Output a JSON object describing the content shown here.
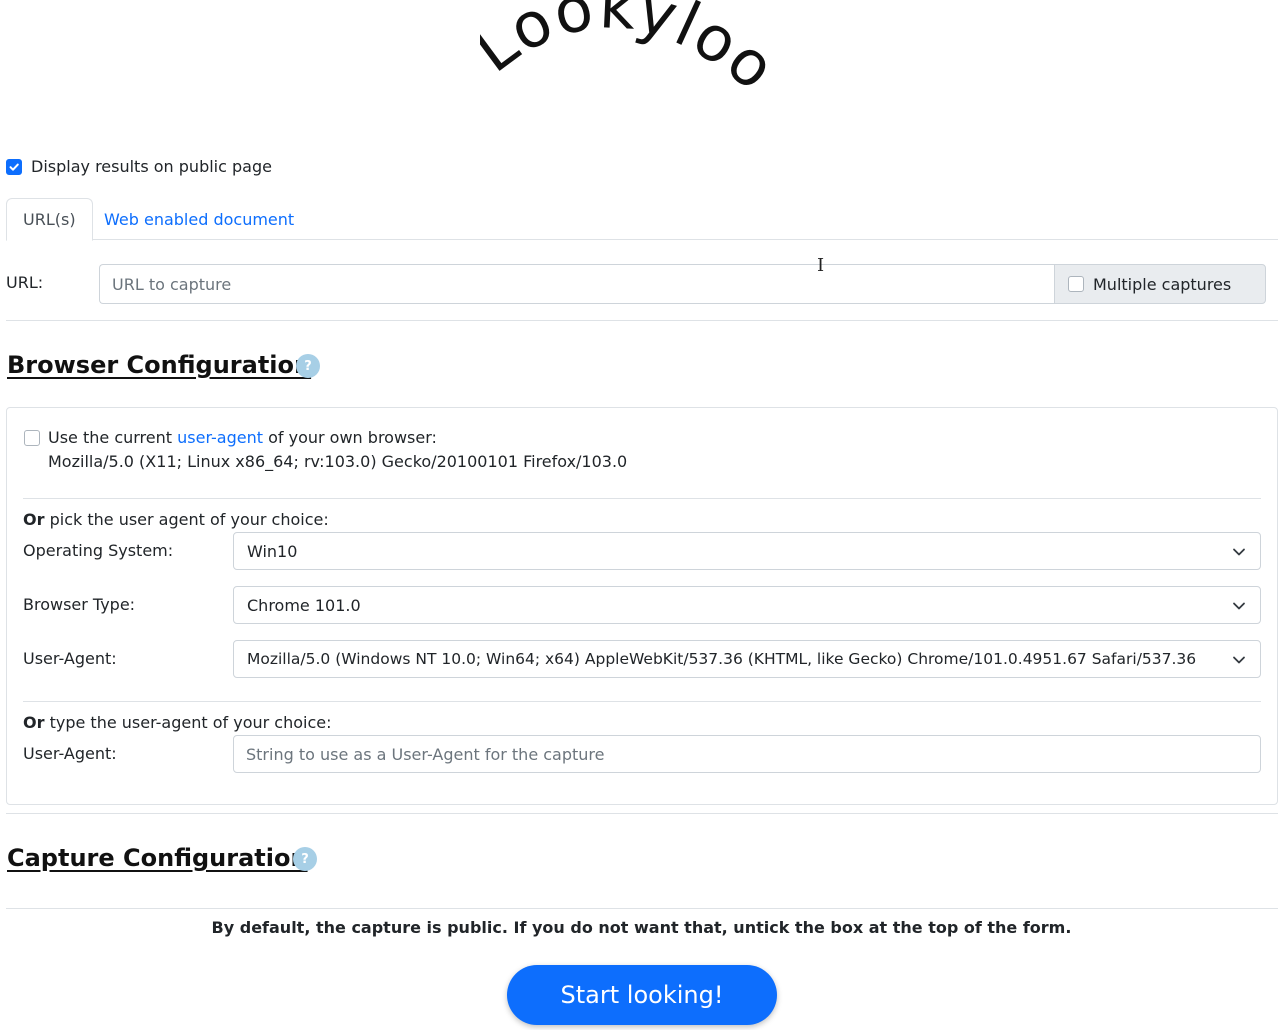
{
  "logo": {
    "text": "Lookyloo"
  },
  "public_display": {
    "label": "Display results on public page",
    "checked": true
  },
  "tabs": [
    {
      "label": "URL(s)",
      "active": true
    },
    {
      "label": "Web enabled document",
      "active": false
    }
  ],
  "url_form": {
    "label": "URL:",
    "placeholder": "URL to capture",
    "multiple_label": "Multiple captures",
    "multiple_checked": false
  },
  "browser_config": {
    "title": "Browser Configuration",
    "help": "?",
    "use_current_prefix": "Use the current",
    "use_current_link": "user-agent",
    "use_current_suffix": "of your own browser:",
    "current_ua": "Mozilla/5.0 (X11; Linux x86_64; rv:103.0) Gecko/20100101 Firefox/103.0",
    "pick_or": "Or",
    "pick_rest": "pick the user agent of your choice:",
    "os_label": "Operating System:",
    "os_value": "Win10",
    "browser_label": "Browser Type:",
    "browser_value": "Chrome 101.0",
    "ua_label": "User-Agent:",
    "ua_value": "Mozilla/5.0 (Windows NT 10.0; Win64; x64) AppleWebKit/537.36 (KHTML, like Gecko) Chrome/101.0.4951.67 Safari/537.36",
    "type_or": "Or",
    "type_rest": "type the user-agent of your choice:",
    "custom_ua_label": "User-Agent:",
    "custom_ua_placeholder": "String to use as a User-Agent for the capture"
  },
  "capture_config": {
    "title": "Capture Configuration",
    "help": "?"
  },
  "notice": "By default, the capture is public. If you do not want that, untick the box at the top of the form.",
  "submit": {
    "label": "Start looking!"
  },
  "colors": {
    "primary": "#0d6efd",
    "help_icon": "#a7cfe6",
    "border": "#dee2e6"
  },
  "icons": [
    "checkbox-checked-icon",
    "checkbox-icon",
    "help-icon",
    "chevron-down-icon",
    "text-cursor-icon"
  ]
}
